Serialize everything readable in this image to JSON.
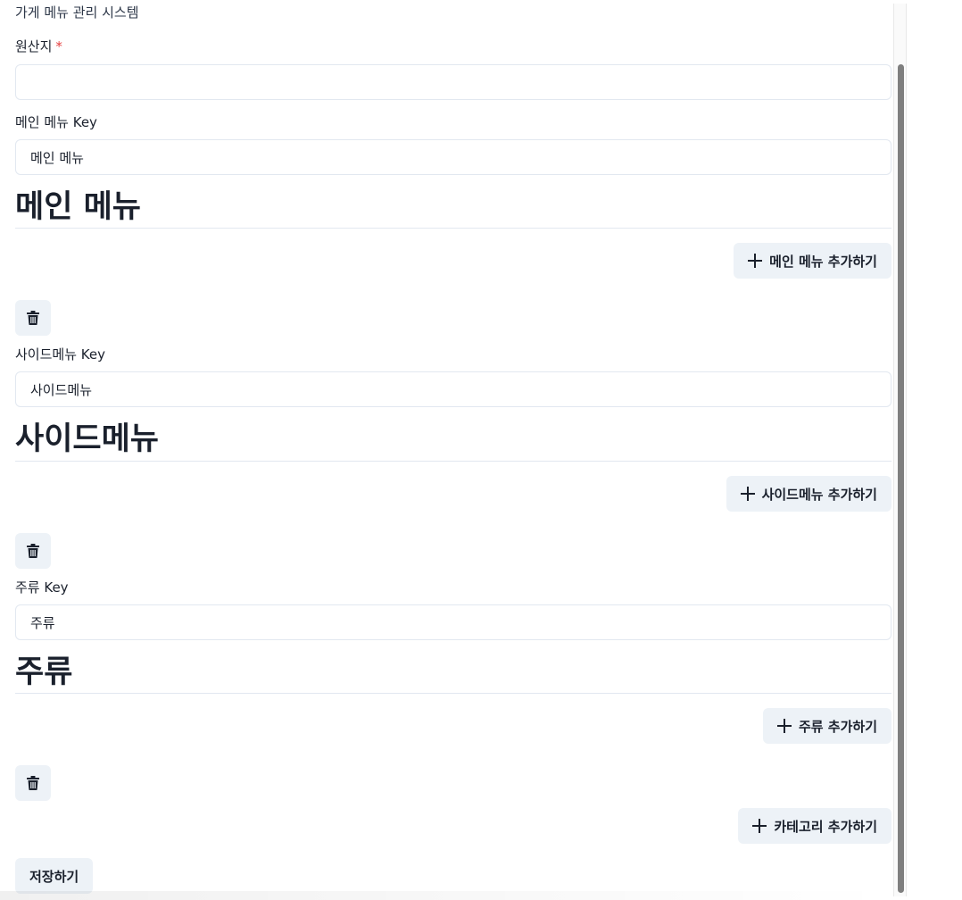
{
  "app": {
    "title": "가게 메뉴 관리 시스템"
  },
  "origin": {
    "label": "원산지",
    "required_mark": "*",
    "value": "",
    "placeholder": ""
  },
  "main_menu": {
    "key_label": "메인 메뉴 Key",
    "key_value": "메인 메뉴",
    "heading": "메인 메뉴",
    "add_button": "메인 메뉴 추가하기"
  },
  "side_menu": {
    "key_label": "사이드메뉴 Key",
    "key_value": "사이드메뉴",
    "heading": "사이드메뉴",
    "add_button": "사이드메뉴 추가하기"
  },
  "drinks": {
    "key_label": "주류 Key",
    "key_value": "주류",
    "heading": "주류",
    "add_button": "주류 추가하기"
  },
  "category": {
    "add_button": "카테고리 추가하기"
  },
  "save_button": "저장하기",
  "icons": {
    "plus": "plus-icon",
    "delete": "trash-icon"
  },
  "colors": {
    "button_bg": "#edf2f7",
    "border": "#e2e8f0",
    "required": "#e53e3e",
    "text": "#1a202c"
  }
}
